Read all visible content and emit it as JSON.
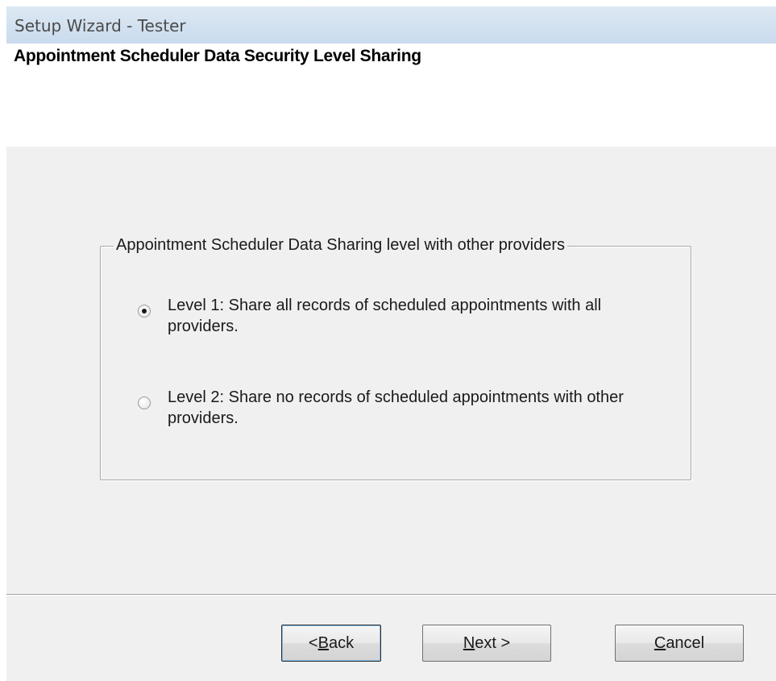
{
  "window": {
    "title": "Setup Wizard - Tester"
  },
  "header": {
    "title": "Appointment Scheduler Data Security Level Sharing"
  },
  "group": {
    "legend": "Appointment Scheduler Data Sharing level with other providers",
    "options": [
      {
        "label": "Level 1: Share all records of scheduled appointments with all providers.",
        "selected": true
      },
      {
        "label": "Level 2: Share no records of scheduled appointments with other providers.",
        "selected": false
      }
    ]
  },
  "buttons": {
    "back": {
      "prefix": "< ",
      "accel": "B",
      "rest": "ack"
    },
    "next": {
      "accel": "N",
      "rest": "ext >"
    },
    "cancel": {
      "accel": "C",
      "rest": "ancel"
    }
  }
}
